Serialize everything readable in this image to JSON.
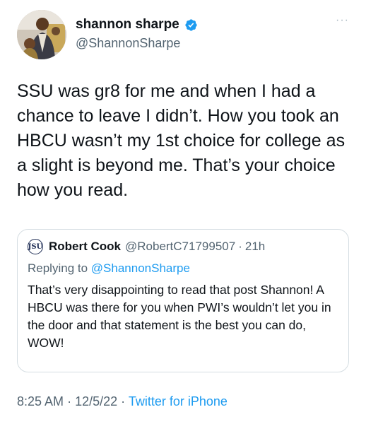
{
  "author": {
    "display_name": "shannon sharpe",
    "handle": "@ShannonSharpe"
  },
  "colors": {
    "text": "#0f1419",
    "secondary": "#536471",
    "accent": "#1d9bf0",
    "border": "#d5dde2"
  },
  "icons": {
    "verified": "verified-badge-icon",
    "more": "more-dots-icon"
  },
  "tweet_text": "SSU was gr8 for me and when I had a chance to leave I didn’t. How you took an HBCU wasn’t my 1st choice for college as a slight is beyond me. That’s your choice how you read.",
  "quoted_tweet": {
    "avatar_text": "JSU",
    "display_name": "Robert Cook",
    "handle": "@RobertC71799507",
    "separator": "·",
    "time": "21h",
    "replying_prefix": "Replying to",
    "replying_to": "@ShannonSharpe",
    "text": "That’s very disappointing to read that post Shannon! A HBCU was there for you when PWI’s wouldn’t let you in the door and that statement is the best you can do, WOW!"
  },
  "footer": {
    "time": "8:25 AM",
    "separator": "·",
    "date": "12/5/22",
    "source": "Twitter for iPhone"
  }
}
